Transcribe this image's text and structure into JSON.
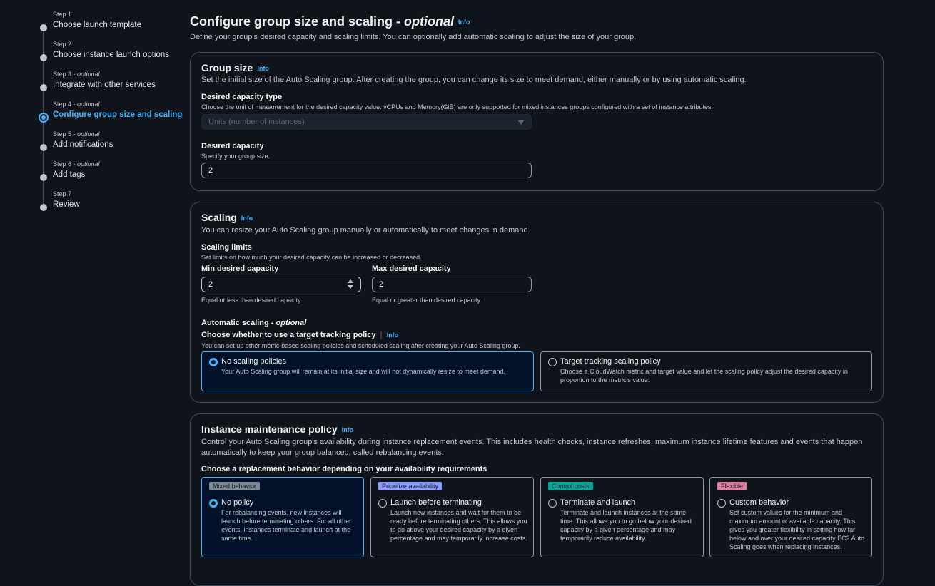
{
  "sidebar": {
    "steps": [
      {
        "num": "Step 1",
        "optional": "",
        "label": "Choose launch template"
      },
      {
        "num": "Step 2",
        "optional": "",
        "label": "Choose instance launch options"
      },
      {
        "num": "Step 3 - ",
        "optional": "optional",
        "label": "Integrate with other services"
      },
      {
        "num": "Step 4 - ",
        "optional": "optional",
        "label": "Configure group size and scaling"
      },
      {
        "num": "Step 5 - ",
        "optional": "optional",
        "label": "Add notifications"
      },
      {
        "num": "Step 6 - ",
        "optional": "optional",
        "label": "Add tags"
      },
      {
        "num": "Step 7",
        "optional": "",
        "label": "Review"
      }
    ]
  },
  "header": {
    "title": "Configure group size and scaling - ",
    "title_optional": "optional",
    "info": "Info",
    "description": "Define your group's desired capacity and scaling limits. You can optionally add automatic scaling to adjust the size of your group."
  },
  "group_size": {
    "title": "Group size",
    "info": "Info",
    "description": "Set the initial size of the Auto Scaling group. After creating the group, you can change its size to meet demand, either manually or by using automatic scaling.",
    "capacity_type_label": "Desired capacity type",
    "capacity_type_hint": "Choose the unit of measurement for the desired capacity value. vCPUs and Memory(GiB) are only supported for mixed instances groups configured with a set of instance attributes.",
    "capacity_type_value": "Units (number of instances)",
    "desired_label": "Desired capacity",
    "desired_hint": "Specify your group size.",
    "desired_value": "2"
  },
  "scaling": {
    "title": "Scaling",
    "info": "Info",
    "description": "You can resize your Auto Scaling group manually or automatically to meet changes in demand.",
    "limits_label": "Scaling limits",
    "limits_hint": "Set limits on how much your desired capacity can be increased or decreased.",
    "min_label": "Min desired capacity",
    "min_value": "2",
    "min_hint": "Equal or less than desired capacity",
    "max_label": "Max desired capacity",
    "max_value": "2",
    "max_hint": "Equal or greater than desired capacity",
    "auto_label": "Automatic scaling - ",
    "auto_optional": "optional",
    "policy_label": "Choose whether to use a target tracking policy",
    "policy_info": "Info",
    "policy_hint": "You can set up other metric-based scaling policies and scheduled scaling after creating your Auto Scaling group.",
    "options": [
      {
        "title": "No scaling policies",
        "desc": "Your Auto Scaling group will remain at its initial size and will not dynamically resize to meet demand.",
        "selected": true
      },
      {
        "title": "Target tracking scaling policy",
        "desc": "Choose a CloudWatch metric and target value and let the scaling policy adjust the desired capacity in proportion to the metric's value.",
        "selected": false
      }
    ]
  },
  "maintenance": {
    "title": "Instance maintenance policy",
    "info": "Info",
    "description": "Control your Auto Scaling group's availability during instance replacement events. This includes health checks, instance refreshes, maximum instance lifetime features and events that happen automatically to keep your group balanced, called rebalancing events.",
    "choose_label": "Choose a replacement behavior depending on your availability requirements",
    "options": [
      {
        "badge": "Mixed behavior",
        "badge_bg": "#7d8998",
        "badge_fg": "#0f141a",
        "title": "No policy",
        "desc": "For rebalancing events, new instances will launch before terminating others. For all other events, instances terminate and launch at the same time.",
        "selected": true
      },
      {
        "badge": "Prioritize availability",
        "badge_bg": "#8c9bff",
        "badge_fg": "#0f141a",
        "title": "Launch before terminating",
        "desc": "Launch new instances and wait for them to be ready before terminating others. This allows you to go above your desired capacity by a given percentage and may temporarily increase costs.",
        "selected": false
      },
      {
        "badge": "Control costs",
        "badge_bg": "#00a896",
        "badge_fg": "#0f141a",
        "title": "Terminate and launch",
        "desc": "Terminate and launch instances at the same time. This allows you to go below your desired capacity by a given percentage and may temporarily reduce availability.",
        "selected": false
      },
      {
        "badge": "Flexible",
        "badge_bg": "#e07ba0",
        "badge_fg": "#0f141a",
        "title": "Custom behavior",
        "desc": "Set custom values for the minimum and maximum amount of available capacity. This gives you greater flexibility in setting how far below and over your desired capacity EC2 Auto Scaling goes when replacing instances.",
        "selected": false
      }
    ]
  }
}
